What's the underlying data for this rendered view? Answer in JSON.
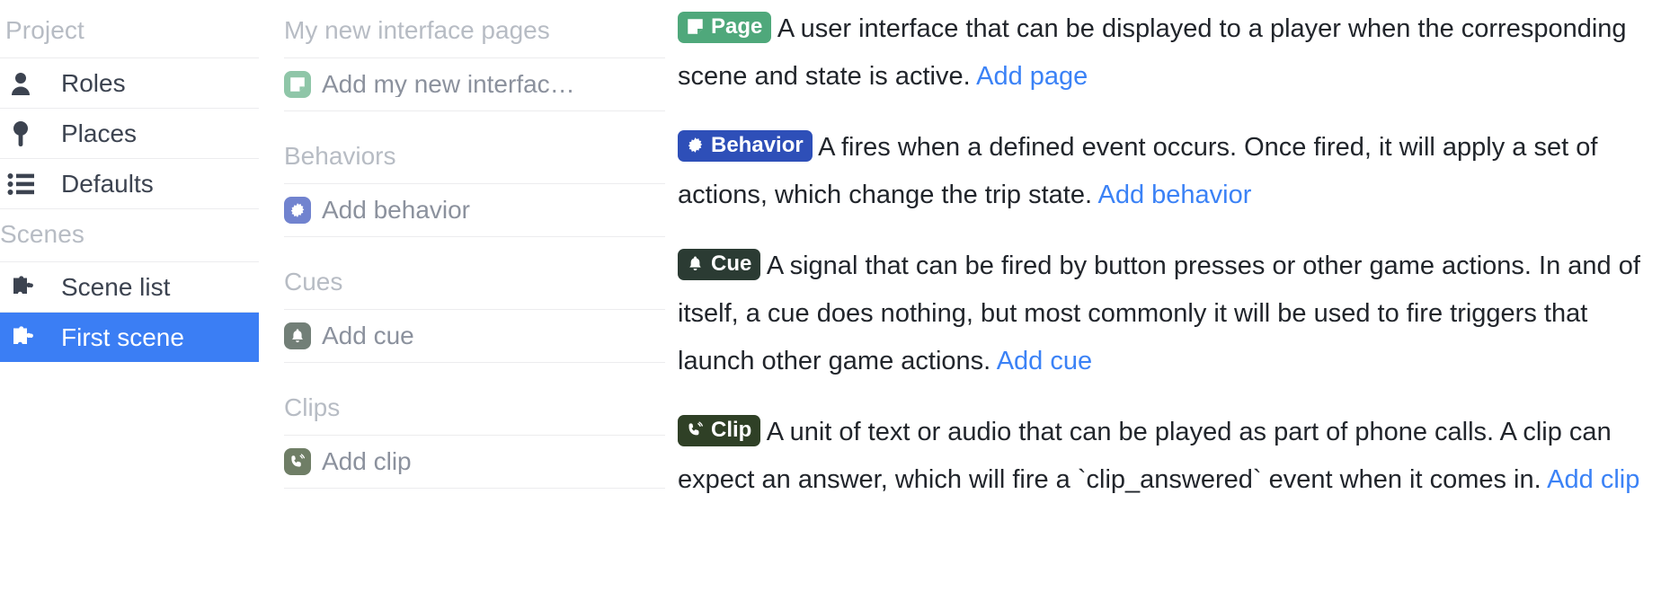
{
  "colors": {
    "accent_blue": "#3b7ef4",
    "link_blue": "#3b82f6",
    "page_green": "#4fa87b",
    "page_chip_green": "#8fc6a8",
    "behavior_blue": "#2e4fb8",
    "behavior_chip_blue": "#7183cf",
    "cue_dark": "#2b3b33",
    "cue_chip_gray": "#727f77",
    "clip_dark": "#2f4026",
    "clip_chip_gray": "#6f7e66",
    "muted_text": "#b7bcc4",
    "body_text": "#21252b",
    "row_text": "#8b919d",
    "divider": "#ececee"
  },
  "sidebar": {
    "sections": [
      {
        "label": "Project",
        "items": [
          {
            "label": "Roles",
            "icon": "person-icon",
            "selected": false
          },
          {
            "label": "Places",
            "icon": "map-pin-icon",
            "selected": false
          },
          {
            "label": "Defaults",
            "icon": "list-icon",
            "selected": false
          }
        ]
      },
      {
        "label": "Scenes",
        "items": [
          {
            "label": "Scene list",
            "icon": "puzzle-piece-icon",
            "selected": false
          },
          {
            "label": "First scene",
            "icon": "puzzle-piece-icon",
            "selected": true
          }
        ]
      }
    ]
  },
  "middle": {
    "groups": [
      {
        "title": "My new interface pages",
        "row_label": "Add my new interfac…",
        "row_icon": "page-icon"
      },
      {
        "title": "Behaviors",
        "row_label": "Add behavior",
        "row_icon": "behavior-burst-icon"
      },
      {
        "title": "Cues",
        "row_label": "Add cue",
        "row_icon": "bell-icon"
      },
      {
        "title": "Clips",
        "row_label": "Add clip",
        "row_icon": "phone-waves-icon"
      }
    ]
  },
  "right": {
    "entries": [
      {
        "badge_label": "Page",
        "badge_icon": "page-icon",
        "text": "A user interface that can be displayed to a player when the corresponding scene and state is active.",
        "link": "Add page"
      },
      {
        "badge_label": "Behavior",
        "badge_icon": "behavior-burst-icon",
        "text": "A fires when a defined event occurs. Once fired, it will apply a set of actions, which change the trip state.",
        "link": "Add behavior"
      },
      {
        "badge_label": "Cue",
        "badge_icon": "bell-icon",
        "text": "A signal that can be fired by button presses or other game actions. In and of itself, a cue does nothing, but most commonly it will be used to fire triggers that launch other game actions.",
        "link": "Add cue"
      },
      {
        "badge_label": "Clip",
        "badge_icon": "phone-waves-icon",
        "text_before": "A unit of text or audio that can be played as part of phone calls. A clip can expect an answer, which will fire a",
        "code": "`clip_answered`",
        "text_after": "event when it comes in.",
        "link": "Add clip"
      }
    ]
  }
}
